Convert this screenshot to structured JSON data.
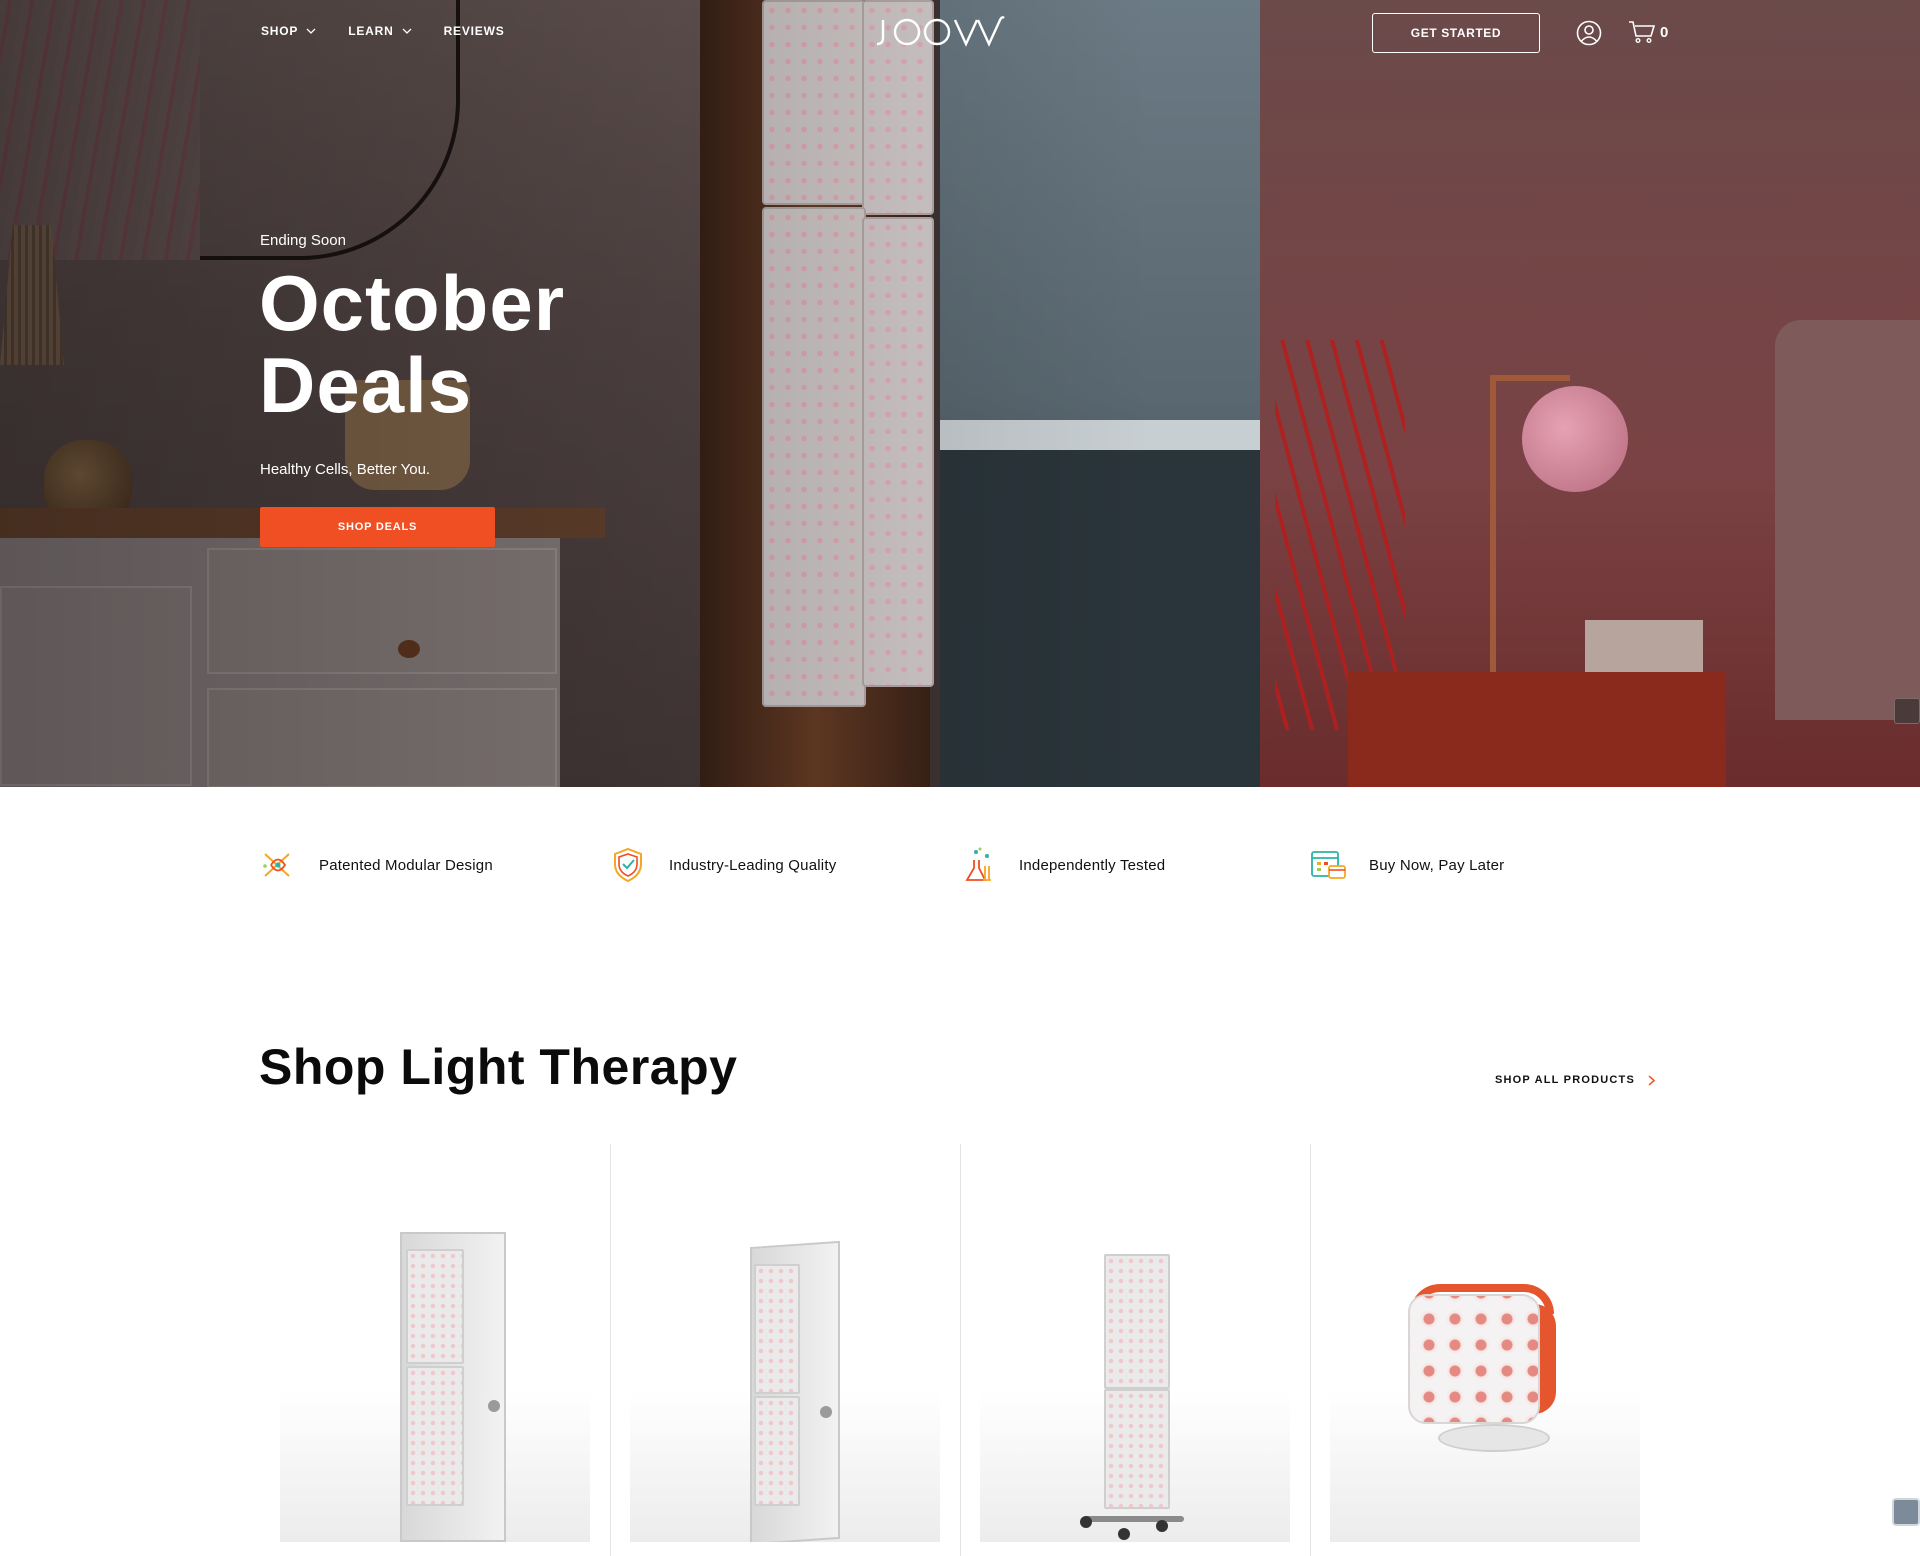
{
  "header": {
    "nav": [
      {
        "label": "SHOP",
        "has_dropdown": true
      },
      {
        "label": "LEARN",
        "has_dropdown": true
      },
      {
        "label": "REVIEWS",
        "has_dropdown": false
      }
    ],
    "logo_text": "JOOVV",
    "get_started_label": "GET STARTED",
    "cart_count": "0"
  },
  "hero": {
    "eyebrow": "Ending Soon",
    "title_line1": "October",
    "title_line2": "Deals",
    "subtitle": "Healthy Cells, Better You.",
    "cta_label": "SHOP DEALS"
  },
  "features": [
    {
      "label": "Patented Modular Design",
      "icon": "modular-design-icon"
    },
    {
      "label": "Industry-Leading Quality",
      "icon": "quality-shield-icon"
    },
    {
      "label": "Independently Tested",
      "icon": "lab-flask-icon"
    },
    {
      "label": "Buy Now, Pay Later",
      "icon": "calendar-card-icon"
    }
  ],
  "shop_section": {
    "title": "Shop Light Therapy",
    "shop_all_label": "SHOP ALL PRODUCTS"
  },
  "products": [
    {
      "image": "door-mounted-twin-panel-device"
    },
    {
      "image": "door-mounted-tall-panel-device"
    },
    {
      "image": "floor-stand-panel-device"
    },
    {
      "image": "handheld-go-device"
    }
  ],
  "colors": {
    "accent": "#f04e23",
    "text": "#111111",
    "hero_text": "#ffffff"
  }
}
